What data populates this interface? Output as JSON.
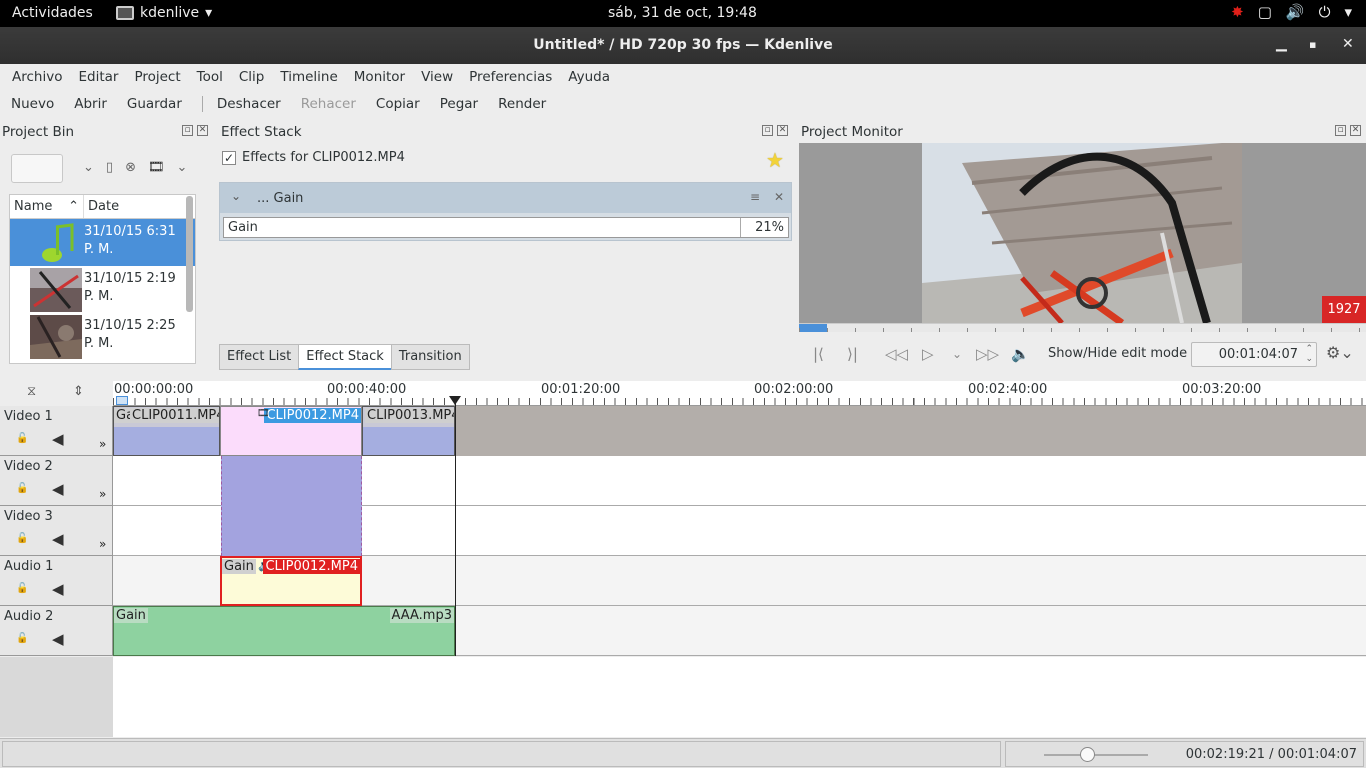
{
  "topbar": {
    "activities": "Actividades",
    "app_name": "kdenlive",
    "clock": "sáb, 31 de oct, 19:48"
  },
  "window": {
    "title": "Untitled* / HD 720p 30 fps — Kdenlive"
  },
  "menu": [
    "Archivo",
    "Editar",
    "Project",
    "Tool",
    "Clip",
    "Timeline",
    "Monitor",
    "View",
    "Preferencias",
    "Ayuda"
  ],
  "toolbar": {
    "nuevo": "Nuevo",
    "abrir": "Abrir",
    "guardar": "Guardar",
    "deshacer": "Deshacer",
    "rehacer": "Rehacer",
    "copiar": "Copiar",
    "pegar": "Pegar",
    "render": "Render"
  },
  "project_bin": {
    "title": "Project Bin",
    "col_name": "Name",
    "col_date": "Date",
    "items": [
      {
        "date": "31/10/15 6:31",
        "date2": "P. M.",
        "kind": "audio"
      },
      {
        "date": "31/10/15 2:19",
        "date2": "P. M.",
        "kind": "video"
      },
      {
        "date": "31/10/15 2:25",
        "date2": "P. M.",
        "kind": "video"
      }
    ]
  },
  "effect_stack": {
    "title": "Effect Stack",
    "effects_for": "Effects for CLIP0012.MP4",
    "effect_name": "... Gain",
    "param_label": "Gain",
    "param_value": "21%",
    "tabs": [
      "Effect List",
      "Effect Stack",
      "Transition"
    ]
  },
  "monitor": {
    "title": "Project Monitor",
    "frame_number": "1927",
    "edit_mode_label": "Show/Hide edit mode",
    "timecode": "00:01:04:07",
    "progress": 0.05
  },
  "timeline": {
    "ruler_labels": [
      "00:00:00:00",
      "00:00:40:00",
      "00:01:20:00",
      "00:02:00:00",
      "00:02:40:00",
      "00:03:20:00"
    ],
    "tracks": [
      "Video 1",
      "Video 2",
      "Video 3",
      "Audio 1",
      "Audio 2"
    ],
    "clips": {
      "v1_a": "CLIP0011.MP4",
      "v1_a_fx": "Ga",
      "v1_b": "CLIP0012.MP4",
      "v1_c": "CLIP0013.MP4",
      "a1_fx": "Gain",
      "a1": "CLIP0012.MP4",
      "a2_fx": "Gain",
      "a2": "AAA.mp3"
    }
  },
  "statusbar": {
    "timecode": "00:02:19:21 / 00:01:04:07"
  },
  "colors": {
    "selection": "#4a90d9",
    "video_clip": "#a5a9df",
    "audio_clip": "#8ed2a0",
    "selected_clip": "#fbdcfb",
    "red_badge": "#d82626"
  }
}
